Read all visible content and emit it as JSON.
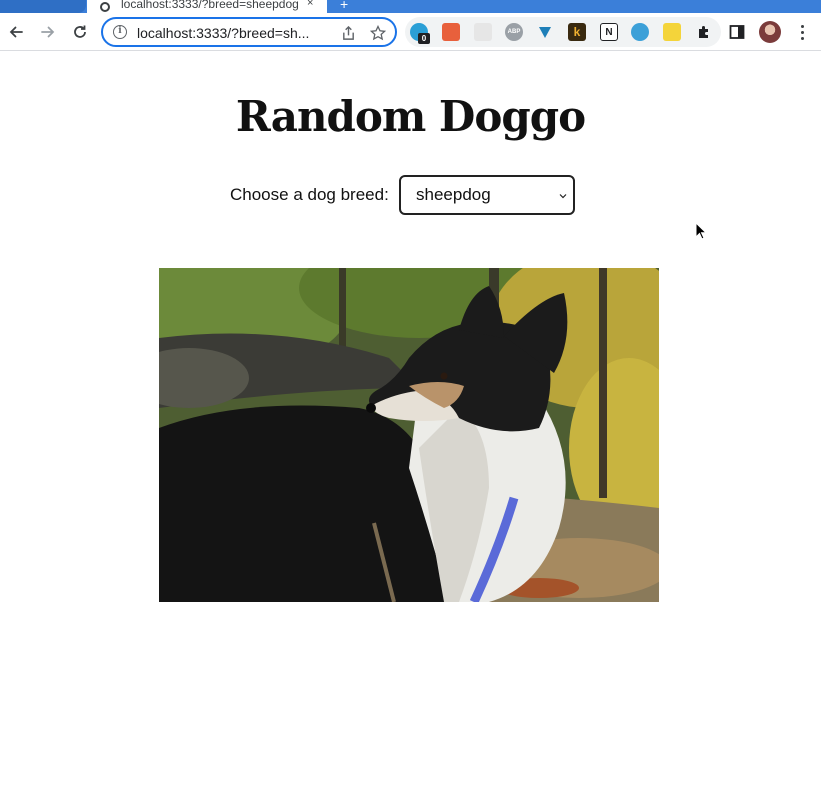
{
  "browser": {
    "tab_title": "localhost:3333/?breed=sheepdog",
    "tab_close": "×",
    "new_tab": "+",
    "url": "localhost:3333/?breed=sh...",
    "extension_badge": "0",
    "icons": {
      "back": "back-arrow-icon",
      "forward": "forward-arrow-icon",
      "reload": "reload-icon",
      "info": "site-info-icon",
      "share": "share-icon",
      "bookmark": "star-icon",
      "extensions": "puzzle-icon",
      "side_panel": "side-panel-icon",
      "menu": "kebab-menu-icon"
    },
    "extension_labels": {
      "abp": "ABP",
      "k": "k",
      "notion": "N"
    }
  },
  "page": {
    "title": "Random Doggo",
    "breed_label": "Choose a dog breed:",
    "breed_selected": "sheepdog",
    "image_alt": "sheepdog photo"
  },
  "colors": {
    "accent": "#1a73e8",
    "tabstrip": "#3b7fd9",
    "text": "#111111"
  }
}
